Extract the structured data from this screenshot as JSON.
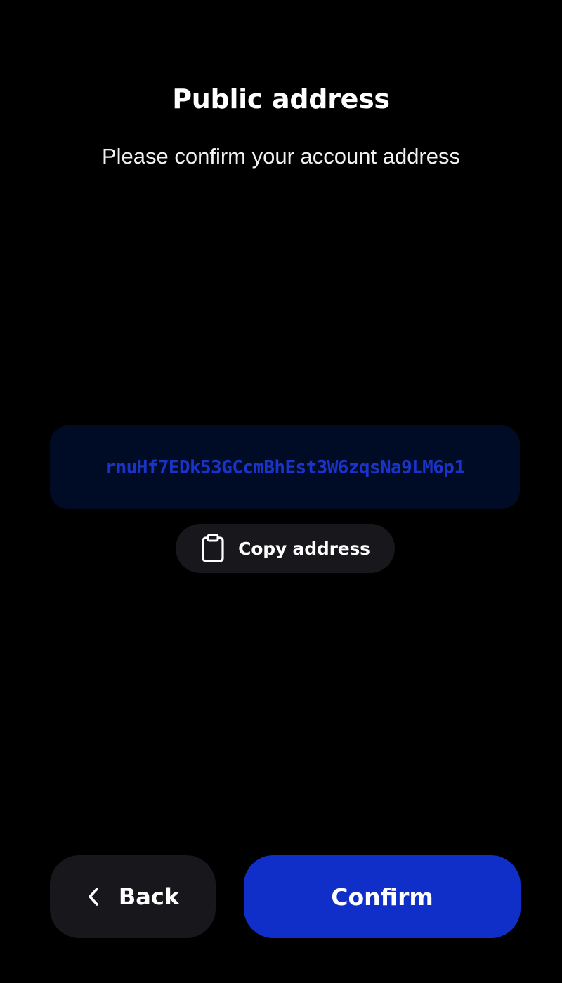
{
  "header": {
    "title": "Public address",
    "subtitle": "Please confirm your account address"
  },
  "address": {
    "value": "rnuHf7EDk53GCcmBhEst3W6zqsNa9LM6p1"
  },
  "copy_button": {
    "label": "Copy address",
    "icon": "clipboard-icon"
  },
  "footer": {
    "back_label": "Back",
    "back_icon": "chevron-left-icon",
    "confirm_label": "Confirm"
  },
  "colors": {
    "background": "#000000",
    "address_box": "#000b26",
    "address_text": "#1a34c9",
    "secondary_button": "#18181c",
    "primary_button": "#102ec8"
  }
}
